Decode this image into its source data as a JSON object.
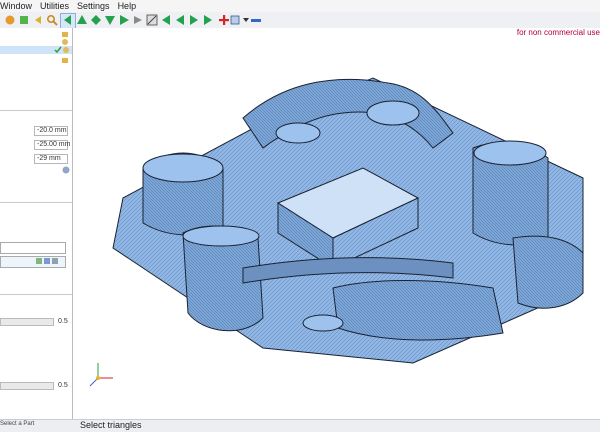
{
  "menubar": {
    "items": [
      "Window",
      "Utilities",
      "Settings",
      "Help"
    ]
  },
  "left_panel": {
    "values": {
      "v1": "-20.0 mm",
      "v2": "-25.00 mm",
      "v3": "-29 mm"
    },
    "slider_value_a": "0.5",
    "slider_value_b": "0.5"
  },
  "viewport": {
    "message": "for non commercial use"
  },
  "statusbar": {
    "left": "Select a Part",
    "main": "Select triangles"
  },
  "colors": {
    "model": "#8eb6e6",
    "model_dark": "#6b91bf",
    "edge": "#2a3140"
  }
}
